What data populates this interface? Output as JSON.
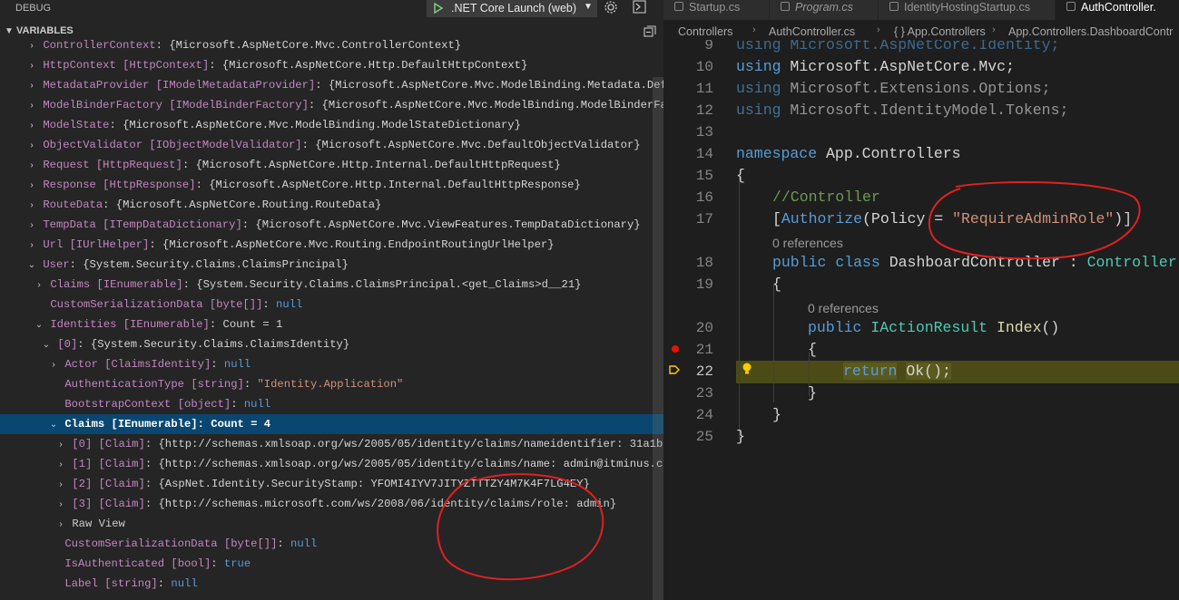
{
  "topbar": {
    "debug_title": "DEBUG",
    "launch_config": ".NET Core Launch (web)"
  },
  "variables": {
    "title": "VARIABLES",
    "rows": [
      {
        "name": "ControllerContext",
        "type": "",
        "value": "{Microsoft.AspNetCore.Mvc.ControllerContext}"
      },
      {
        "name": "HttpContext",
        "type": "[HttpContext]",
        "value": "{Microsoft.AspNetCore.Http.DefaultHttpContext}"
      },
      {
        "name": "MetadataProvider",
        "type": "[IModelMetadataProvider]",
        "value": "{Microsoft.AspNetCore.Mvc.ModelBinding.Metadata.Defa"
      },
      {
        "name": "ModelBinderFactory",
        "type": "[IModelBinderFactory]",
        "value": "{Microsoft.AspNetCore.Mvc.ModelBinding.ModelBinderFac"
      },
      {
        "name": "ModelState",
        "type": "",
        "value": "{Microsoft.AspNetCore.Mvc.ModelBinding.ModelStateDictionary}"
      },
      {
        "name": "ObjectValidator",
        "type": "[IObjectModelValidator]",
        "value": "{Microsoft.AspNetCore.Mvc.DefaultObjectValidator}"
      },
      {
        "name": "Request",
        "type": "[HttpRequest]",
        "value": "{Microsoft.AspNetCore.Http.Internal.DefaultHttpRequest}"
      },
      {
        "name": "Response",
        "type": "[HttpResponse]",
        "value": "{Microsoft.AspNetCore.Http.Internal.DefaultHttpResponse}"
      },
      {
        "name": "RouteData",
        "type": "",
        "value": "{Microsoft.AspNetCore.Routing.RouteData}"
      },
      {
        "name": "TempData",
        "type": "[ITempDataDictionary]",
        "value": "{Microsoft.AspNetCore.Mvc.ViewFeatures.TempDataDictionary}"
      },
      {
        "name": "Url",
        "type": "[IUrlHelper]",
        "value": "{Microsoft.AspNetCore.Mvc.Routing.EndpointRoutingUrlHelper}"
      },
      {
        "name": "User",
        "type": "",
        "value": "{System.Security.Claims.ClaimsPrincipal}"
      },
      {
        "name": "Claims",
        "type": "[IEnumerable]",
        "value": "{System.Security.Claims.ClaimsPrincipal.<get_Claims>d__21}"
      },
      {
        "name": "CustomSerializationData",
        "type": "[byte[]]",
        "value": "null"
      },
      {
        "name": "Identities",
        "type": "[IEnumerable]",
        "value": "Count = 1"
      },
      {
        "name": "[0]",
        "type": "",
        "value": "{System.Security.Claims.ClaimsIdentity}"
      },
      {
        "name": "Actor",
        "type": "[ClaimsIdentity]",
        "value": "null"
      },
      {
        "name": "AuthenticationType",
        "type": "[string]",
        "value": "\"Identity.Application\""
      },
      {
        "name": "BootstrapContext",
        "type": "[object]",
        "value": "null"
      },
      {
        "name": "Claims",
        "type": "[IEnumerable]",
        "value": "Count = 4"
      },
      {
        "name": "[0]",
        "type": "[Claim]",
        "value": "{http://schemas.xmlsoap.org/ws/2005/05/identity/claims/nameidentifier: 31a1b5"
      },
      {
        "name": "[1]",
        "type": "[Claim]",
        "value": "{http://schemas.xmlsoap.org/ws/2005/05/identity/claims/name: admin@itminus.co"
      },
      {
        "name": "[2]",
        "type": "[Claim]",
        "value": "{AspNet.Identity.SecurityStamp: YFOMI4IYV7JITYZTTTZY4M7K4F7LG4EY}"
      },
      {
        "name": "[3]",
        "type": "[Claim]",
        "value": "{http://schemas.microsoft.com/ws/2008/06/identity/claims/role: admin}"
      },
      {
        "name": "Raw View",
        "type": "",
        "value": ""
      },
      {
        "name": "CustomSerializationData",
        "type": "[byte[]]",
        "value": "null"
      },
      {
        "name": "IsAuthenticated",
        "type": "[bool]",
        "value": "true"
      },
      {
        "name": "Label",
        "type": "[string]",
        "value": "null"
      }
    ]
  },
  "tabs": [
    {
      "label": "Startup.cs"
    },
    {
      "label": "Program.cs"
    },
    {
      "label": "IdentityHostingStartup.cs"
    },
    {
      "label": "AuthController."
    }
  ],
  "breadcrumb": {
    "items": [
      "Controllers",
      "AuthController.cs",
      "{ } App.Controllers",
      "App.Controllers.DashboardContr"
    ]
  },
  "editor": {
    "line_numbers": [
      "9",
      "10",
      "11",
      "12",
      "13",
      "14",
      "15",
      "16",
      "17",
      "",
      "18",
      "19",
      "",
      "20",
      "21",
      "22",
      "23",
      "24",
      "25"
    ],
    "lines": {
      "l9": "using Microsoft.AspNetCore.Identity;",
      "l10_kw": "using",
      "l10_rest": " Microsoft.AspNetCore.Mvc;",
      "l11_kw": "using",
      "l11_rest": " Microsoft.Extensions.Options;",
      "l12_kw": "using",
      "l12_rest": " Microsoft.IdentityModel.Tokens;",
      "l14_kw": "namespace",
      "l14_rest": " App.Controllers",
      "l15": "{",
      "l16": "//Controller",
      "l17_a": "[",
      "l17_attr": "Authorize",
      "l17_b": "(Policy = ",
      "l17_str": "\"RequireAdminRole\"",
      "l17_c": ")]",
      "lens1": "0 references",
      "l18_kw1": "public",
      "l18_kw2": "class",
      "l18_name": " DashboardController : ",
      "l18_base": "Controller",
      "l19": "{",
      "lens2": "0 references",
      "l20_kw": "public",
      "l20_type": "IActionResult",
      "l20_fn": "Index",
      "l20_rest": "()",
      "l21": "{",
      "l22_kw": "return",
      "l22_fn": "Ok",
      "l22_rest": "();",
      "l23": "}",
      "l24": "}",
      "l25": "}"
    }
  }
}
